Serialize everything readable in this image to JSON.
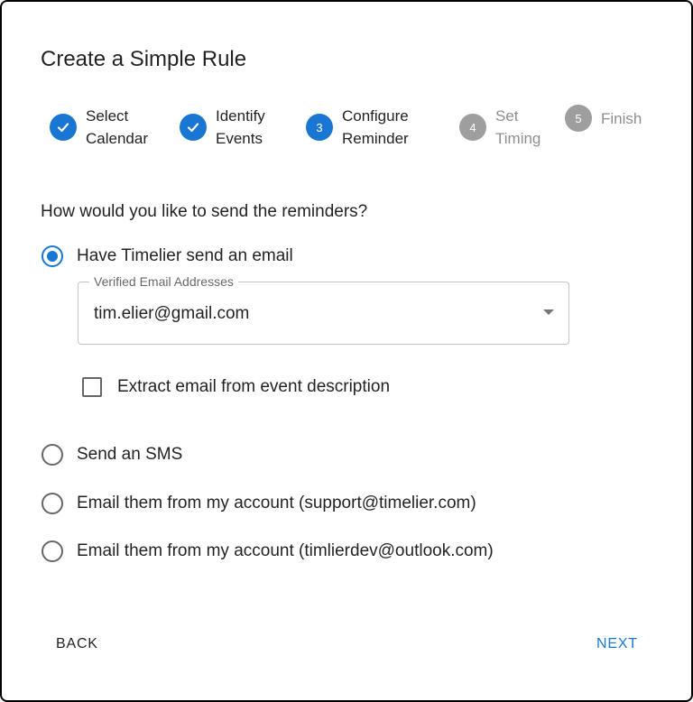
{
  "dialog": {
    "title": "Create a Simple Rule"
  },
  "stepper": {
    "steps": [
      {
        "label": "Select\nCalendar",
        "state": "done",
        "icon": "check-icon"
      },
      {
        "label": "Identify\nEvents",
        "state": "done",
        "icon": "check-icon"
      },
      {
        "label": "Configure\nReminder",
        "state": "active",
        "number": "3"
      },
      {
        "label": "Set\nTiming",
        "state": "pending",
        "number": "4"
      },
      {
        "label": "Finish",
        "state": "pending",
        "number": "5"
      }
    ]
  },
  "form": {
    "question": "How would you like to send the reminders?",
    "options": [
      {
        "label": "Have Timelier send an email",
        "selected": true
      },
      {
        "label": "Send an SMS",
        "selected": false
      },
      {
        "label": "Email them from my account (support@timelier.com)",
        "selected": false
      },
      {
        "label": "Email them from my account (timlierdev@outlook.com)",
        "selected": false
      }
    ],
    "email_select": {
      "label": "Verified Email Addresses",
      "value": "tim.elier@gmail.com"
    },
    "extract_checkbox": {
      "label": "Extract email from event description",
      "checked": false
    }
  },
  "actions": {
    "back_label": "BACK",
    "next_label": "NEXT"
  },
  "colors": {
    "primary": "#1976d2",
    "pending": "#9e9e9e"
  }
}
